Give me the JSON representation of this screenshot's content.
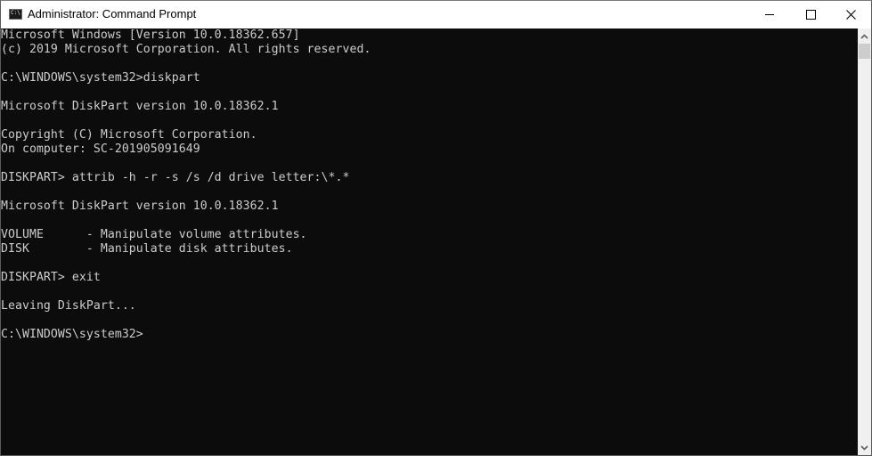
{
  "window": {
    "title": "Administrator: Command Prompt",
    "icon": "cmd-icon",
    "icon_text": "C:\\",
    "controls": {
      "minimize": "minimize-icon",
      "maximize": "maximize-icon",
      "close": "close-icon"
    }
  },
  "console": {
    "lines": [
      "Microsoft Windows [Version 10.0.18362.657]",
      "(c) 2019 Microsoft Corporation. All rights reserved.",
      "",
      "C:\\WINDOWS\\system32>diskpart",
      "",
      "Microsoft DiskPart version 10.0.18362.1",
      "",
      "Copyright (C) Microsoft Corporation.",
      "On computer: SC-201905091649",
      "",
      "DISKPART> attrib -h -r -s /s /d drive letter:\\*.*",
      "",
      "Microsoft DiskPart version 10.0.18362.1",
      "",
      "VOLUME      - Manipulate volume attributes.",
      "DISK        - Manipulate disk attributes.",
      "",
      "DISKPART> exit",
      "",
      "Leaving DiskPart...",
      "",
      "C:\\WINDOWS\\system32>"
    ]
  },
  "scrollbar": {
    "up_glyph": "˄",
    "down_glyph": "˅"
  }
}
